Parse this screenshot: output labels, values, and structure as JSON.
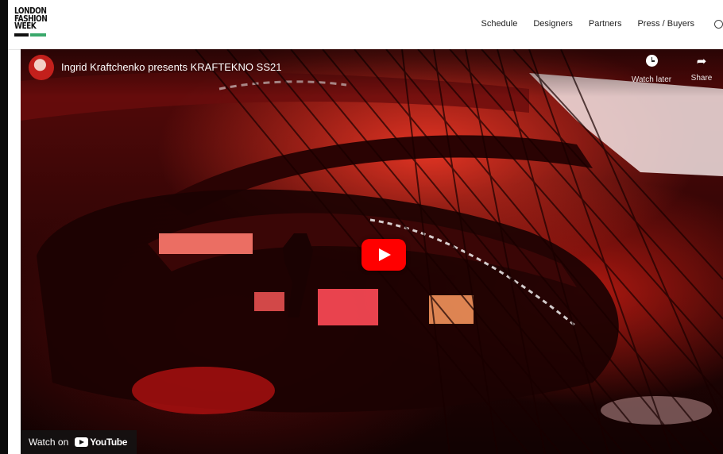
{
  "site": {
    "logo_lines": [
      "LONDON",
      "FASHION",
      "WEEK"
    ],
    "nav": [
      {
        "label": "Schedule"
      },
      {
        "label": "Designers"
      },
      {
        "label": "Partners"
      },
      {
        "label": "Press / Buyers"
      }
    ]
  },
  "video": {
    "title": "Ingrid Kraftchenko presents KRAFTEKNO SS21",
    "watch_later_label": "Watch later",
    "share_label": "Share",
    "watch_on_label": "Watch on",
    "youtube_label": "YouTube"
  },
  "colors": {
    "play_button": "#ff0000",
    "logo_badge": "#3aa86b"
  }
}
